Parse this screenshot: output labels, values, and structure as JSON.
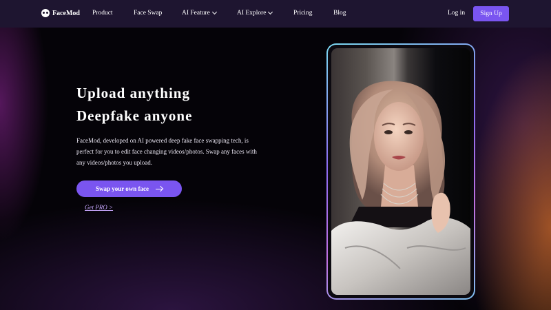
{
  "nav": {
    "logo_text": "FaceMod",
    "items": [
      {
        "label": "Product",
        "dropdown": false
      },
      {
        "label": "Face Swap",
        "dropdown": false
      },
      {
        "label": "AI Feature",
        "dropdown": true
      },
      {
        "label": "AI Explore",
        "dropdown": true
      },
      {
        "label": "Pricing",
        "dropdown": false
      },
      {
        "label": "Blog",
        "dropdown": false
      }
    ],
    "login_label": "Log in",
    "signup_label": "Sign Up"
  },
  "hero": {
    "headline_1": "Upload anything",
    "headline_2": "Deepfake anyone",
    "description": "FaceMod, developed on AI powered deep fake face swapping tech, is perfect for you to edit face changing videos/photos. Swap any faces with any videos/photos you upload.",
    "cta_label": "Swap your own face",
    "cta_icon": "arrow-right-icon",
    "secondary_link": "Get PRO >"
  },
  "colors": {
    "nav_bg": "#1e1530",
    "accent": "#7a55f0",
    "link": "#c8a8ff"
  }
}
